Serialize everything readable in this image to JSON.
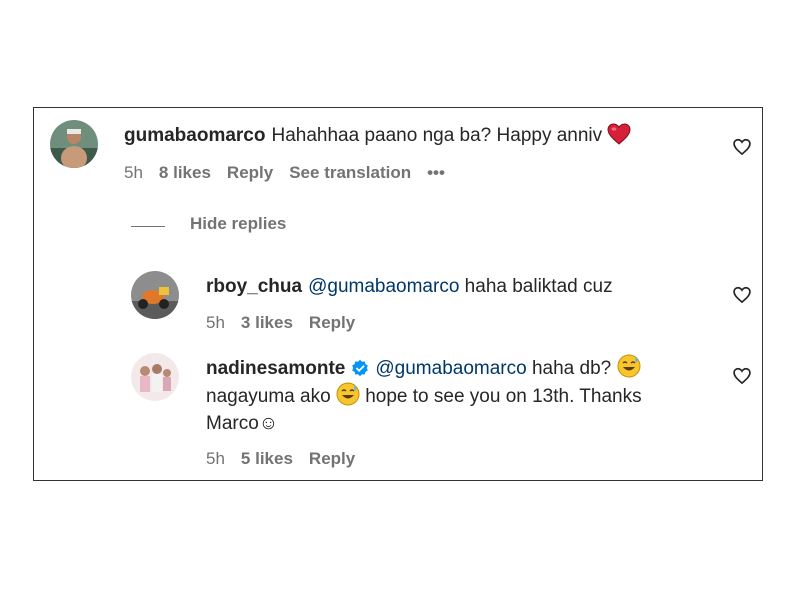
{
  "comments": [
    {
      "username": "gumabaomarco",
      "text": "Hahahhaa paano nga ba? Happy anniv",
      "time": "5h",
      "likes": "8 likes",
      "reply": "Reply",
      "translation": "See translation",
      "more": "•••",
      "emoji": "red-heart"
    }
  ],
  "hide_replies": "Hide replies",
  "replies": [
    {
      "username": "rboy_chua",
      "mention": "@gumabaomarco",
      "text": " haha baliktad cuz",
      "time": "5h",
      "likes": "3 likes",
      "reply": "Reply"
    },
    {
      "username": "nadinesamonte",
      "verified": true,
      "mention": "@gumabaomarco",
      "text_line1": " haha db? ",
      "text_line2a": "nagayuma ako ",
      "text_line2b": " hope to see you on 13th. Thanks",
      "text_line3": "Marco",
      "smile": "☺",
      "time": "5h",
      "likes": "5 likes",
      "reply": "Reply"
    }
  ],
  "colors": {
    "meta": "#737373",
    "mention": "#00376b",
    "verified": "#0095f6",
    "heart_emoji": "#e0245e"
  }
}
